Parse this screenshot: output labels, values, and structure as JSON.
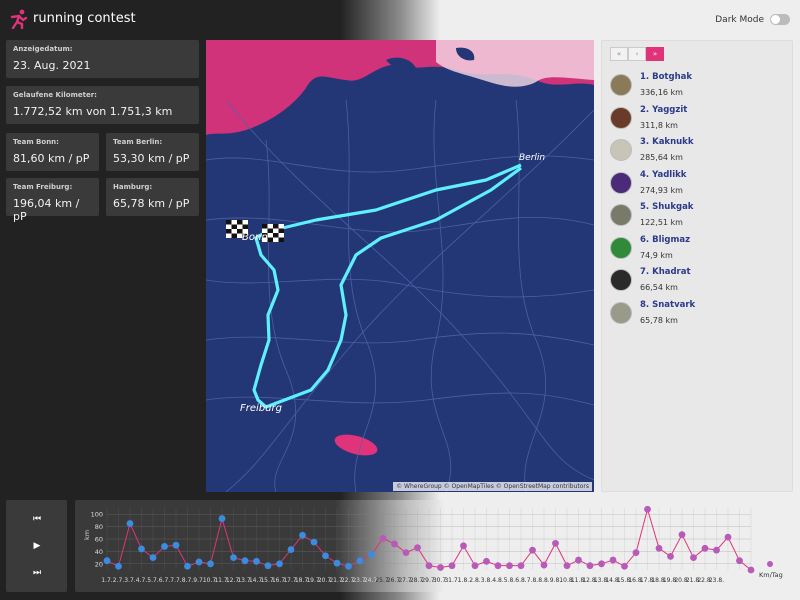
{
  "app": {
    "title": "running contest",
    "dark_mode_label": "Dark Mode"
  },
  "stats": {
    "date": {
      "label": "Anzeigedatum:",
      "value": "23. Aug. 2021"
    },
    "km": {
      "label": "Gelaufene Kilometer:",
      "value": "1.772,52 km von 1.751,3 km"
    },
    "teams": [
      {
        "label": "Team Bonn:",
        "value": "81,60 km / pP"
      },
      {
        "label": "Team Berlin:",
        "value": "53,30 km / pP"
      },
      {
        "label": "Team Freiburg:",
        "value": "196,04 km / pP"
      },
      {
        "label": "Hamburg:",
        "value": "65,78 km / pP"
      }
    ]
  },
  "map": {
    "cities": [
      "Berlin",
      "Bonn",
      "Freiburg"
    ],
    "attribution": "© WhereGroup © OpenMapTiles © OpenStreetMap contributors"
  },
  "pager": {
    "prev": "«",
    "mid": "‹",
    "next": "»"
  },
  "leaderboard": [
    {
      "name": "1. Botghak",
      "km": "336,16 km",
      "color": "#8a7a5a"
    },
    {
      "name": "2. Yaggzit",
      "km": "311,8 km",
      "color": "#6b3b2a"
    },
    {
      "name": "3. Kaknukk",
      "km": "285,64 km",
      "color": "#c9c4b8"
    },
    {
      "name": "4. Yadlikk",
      "km": "274,93 km",
      "color": "#4b2a7a"
    },
    {
      "name": "5. Shukgak",
      "km": "122,51 km",
      "color": "#7a7a6a"
    },
    {
      "name": "6. Bligmaz",
      "km": "74,9 km",
      "color": "#2f8a3a"
    },
    {
      "name": "7. Khadrat",
      "km": "66,54 km",
      "color": "#2a2a2a"
    },
    {
      "name": "8. Snatvark",
      "km": "65,78 km",
      "color": "#9a9a8a"
    }
  ],
  "controls": {
    "prev": "⏮",
    "play": "▶",
    "next": "⏭"
  },
  "chart_data": {
    "type": "line",
    "ylabel": "km",
    "yticks": [
      20,
      40,
      60,
      80,
      100
    ],
    "ylim": [
      10,
      110
    ],
    "legend": "Km/Tag",
    "colors": {
      "line": "#e0337a",
      "point_dark": "#3b8ce0",
      "point_light": "#b85ab8"
    },
    "categories": [
      "1.7.",
      "2.7.",
      "3.7.",
      "4.7.",
      "5.7.",
      "6.7.",
      "7.7.",
      "8.7.",
      "9.7.",
      "10.7.",
      "11.7.",
      "12.7.",
      "13.7.",
      "14.7.",
      "15.7.",
      "16.7.",
      "17.7.",
      "18.7.",
      "19.7.",
      "20.7.",
      "21.7.",
      "22.7.",
      "23.7.",
      "24.7.",
      "25.7.",
      "26.7.",
      "27.7.",
      "28.7.",
      "29.7.",
      "30.7.",
      "31.7.",
      "1.8.",
      "2.8.",
      "3.8.",
      "4.8.",
      "5.8.",
      "6.8.",
      "7.8.",
      "8.8.",
      "9.8.",
      "10.8.",
      "11.8.",
      "12.8.",
      "13.8.",
      "14.8.",
      "15.8.",
      "16.8.",
      "17.8.",
      "18.8.",
      "19.8.",
      "20.8.",
      "21.8.",
      "22.8.",
      "23.8."
    ],
    "values": [
      25,
      16,
      85,
      44,
      30,
      48,
      50,
      16,
      23,
      20,
      93,
      30,
      25,
      24,
      17,
      20,
      43,
      66,
      55,
      33,
      21,
      16,
      25,
      35,
      61,
      52,
      38,
      46,
      17,
      14,
      17,
      49,
      17,
      24,
      17,
      17,
      17,
      42,
      18,
      53,
      17,
      26,
      17,
      20,
      26,
      16,
      38,
      108,
      45,
      32,
      67,
      30,
      45,
      42,
      63,
      25,
      10
    ]
  }
}
